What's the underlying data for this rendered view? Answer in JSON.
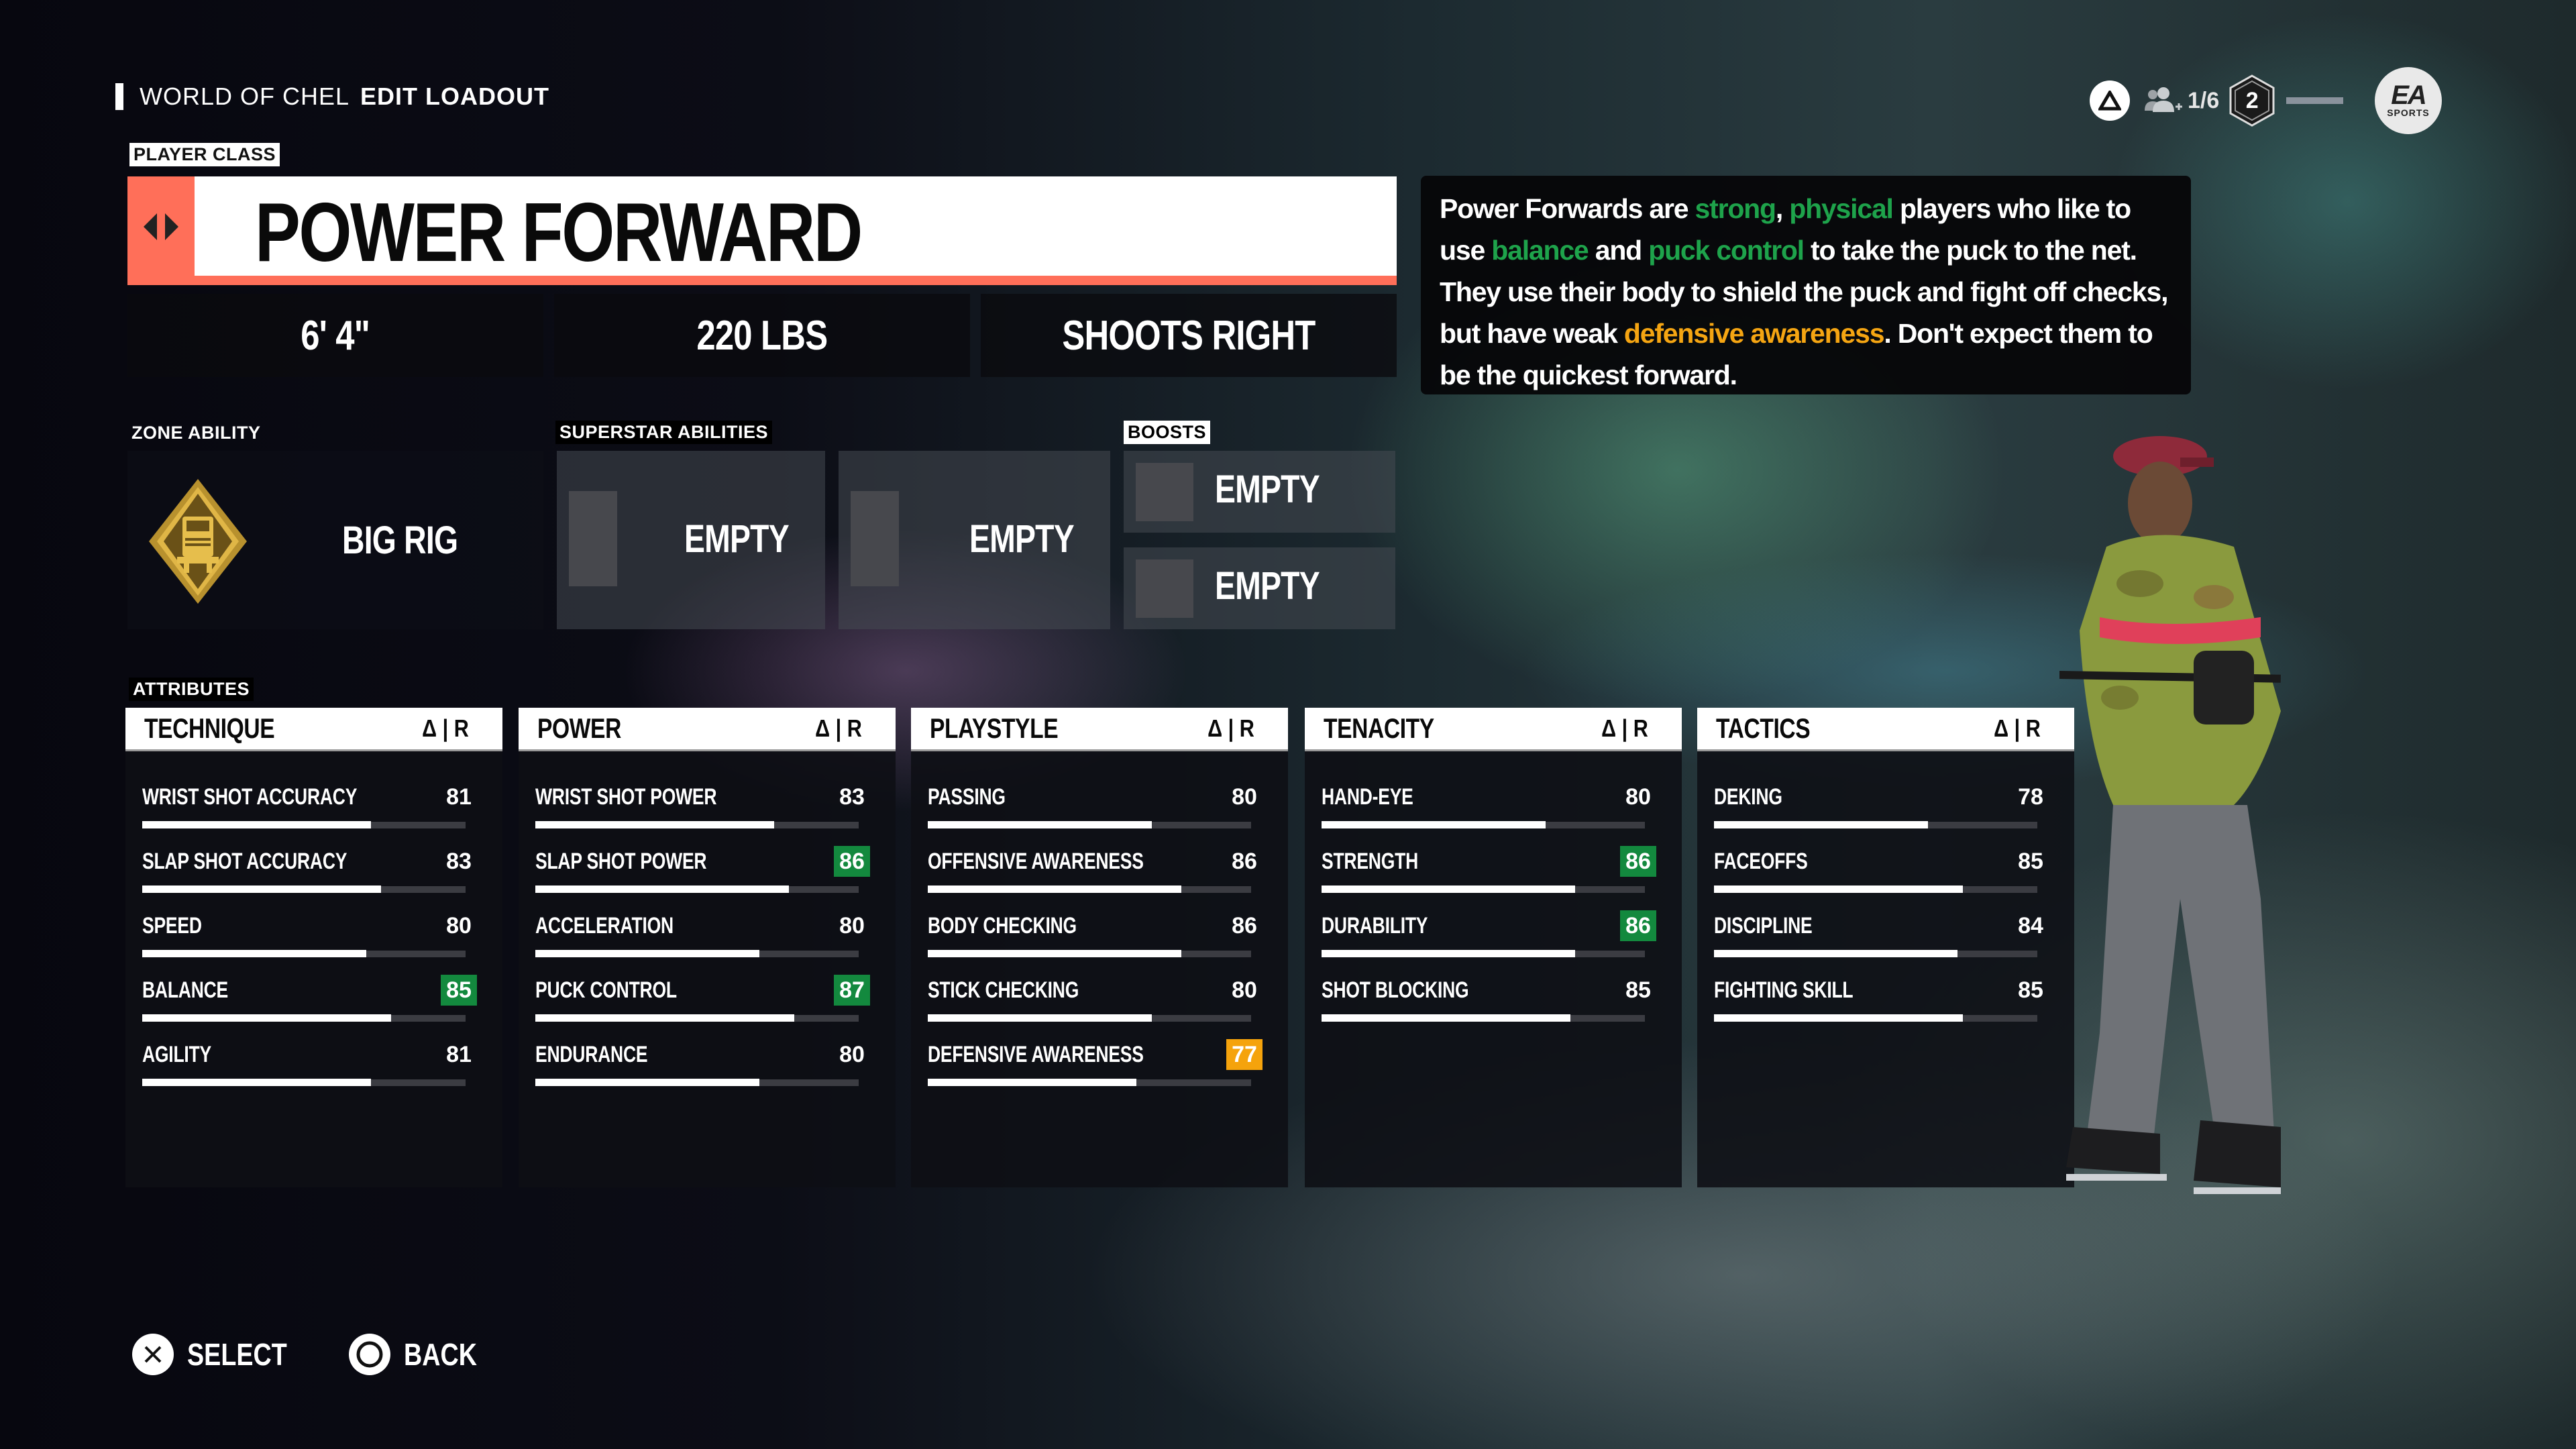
{
  "header": {
    "breadcrumb_section": "WORLD OF CHEL",
    "page_title": "EDIT LOADOUT"
  },
  "hud": {
    "triangle_button_icon": "playstation-triangle-icon",
    "party_icon": "add-party-member-icon",
    "party_count": "1/6",
    "level": "2",
    "brand_logo": {
      "top": "EA",
      "bottom": "SPORTS"
    }
  },
  "player_class": {
    "section_label": "PLAYER CLASS",
    "name": "POWER FORWARD",
    "accent_color": "#ff6f59",
    "height": "6' 4\"",
    "weight": "220 LBS",
    "handedness": "SHOOTS RIGHT"
  },
  "description": {
    "segments": [
      {
        "text": "Power Forwards are ",
        "tone": "normal"
      },
      {
        "text": "strong",
        "tone": "positive"
      },
      {
        "text": ", ",
        "tone": "normal"
      },
      {
        "text": "physical",
        "tone": "positive"
      },
      {
        "text": " players who like to use ",
        "tone": "normal"
      },
      {
        "text": "balance",
        "tone": "positive"
      },
      {
        "text": " and ",
        "tone": "normal"
      },
      {
        "text": "puck control",
        "tone": "positive"
      },
      {
        "text": " to take the puck to the net. They use their body to shield the puck and fight off checks, but have weak ",
        "tone": "normal"
      },
      {
        "text": "defensive awareness",
        "tone": "negative"
      },
      {
        "text": ". Don't expect them to be the quickest forward.",
        "tone": "normal"
      }
    ],
    "colors": {
      "positive": "#1ea34b",
      "negative": "#f5a512",
      "normal": "#ffffff"
    }
  },
  "abilities": {
    "zone_label": "ZONE ABILITY",
    "zone_ability": {
      "name": "BIG RIG",
      "icon": "big-rig-truck-icon"
    },
    "superstar_label": "SUPERSTAR ABILITIES",
    "superstar": [
      {
        "name": "EMPTY"
      },
      {
        "name": "EMPTY"
      }
    ],
    "boosts_label": "BOOSTS",
    "boosts": [
      {
        "name": "EMPTY"
      },
      {
        "name": "EMPTY"
      }
    ]
  },
  "attributes": {
    "section_label": "ATTRIBUTES",
    "column_suffix": "Δ | R",
    "status_colors": {
      "up": "#13893e",
      "down": "#f5a30c"
    },
    "max_value": 100,
    "categories": [
      {
        "name": "TECHNIQUE",
        "items": [
          {
            "label": "WRIST SHOT ACCURACY",
            "value": 81,
            "status": "none"
          },
          {
            "label": "SLAP SHOT ACCURACY",
            "value": 83,
            "status": "none"
          },
          {
            "label": "SPEED",
            "value": 80,
            "status": "none"
          },
          {
            "label": "BALANCE",
            "value": 85,
            "status": "up"
          },
          {
            "label": "AGILITY",
            "value": 81,
            "status": "none"
          }
        ]
      },
      {
        "name": "POWER",
        "items": [
          {
            "label": "WRIST SHOT POWER",
            "value": 83,
            "status": "none"
          },
          {
            "label": "SLAP SHOT POWER",
            "value": 86,
            "status": "up"
          },
          {
            "label": "ACCELERATION",
            "value": 80,
            "status": "none"
          },
          {
            "label": "PUCK CONTROL",
            "value": 87,
            "status": "up"
          },
          {
            "label": "ENDURANCE",
            "value": 80,
            "status": "none"
          }
        ]
      },
      {
        "name": "PLAYSTYLE",
        "items": [
          {
            "label": "PASSING",
            "value": 80,
            "status": "none"
          },
          {
            "label": "OFFENSIVE AWARENESS",
            "value": 86,
            "status": "none"
          },
          {
            "label": "BODY CHECKING",
            "value": 86,
            "status": "none"
          },
          {
            "label": "STICK CHECKING",
            "value": 80,
            "status": "none"
          },
          {
            "label": "DEFENSIVE AWARENESS",
            "value": 77,
            "status": "down"
          }
        ]
      },
      {
        "name": "TENACITY",
        "items": [
          {
            "label": "HAND-EYE",
            "value": 80,
            "status": "none"
          },
          {
            "label": "STRENGTH",
            "value": 86,
            "status": "up"
          },
          {
            "label": "DURABILITY",
            "value": 86,
            "status": "up"
          },
          {
            "label": "SHOT BLOCKING",
            "value": 85,
            "status": "none"
          }
        ]
      },
      {
        "name": "TACTICS",
        "items": [
          {
            "label": "DEKING",
            "value": 78,
            "status": "none"
          },
          {
            "label": "FACEOFFS",
            "value": 85,
            "status": "none"
          },
          {
            "label": "DISCIPLINE",
            "value": 84,
            "status": "none"
          },
          {
            "label": "FIGHTING SKILL",
            "value": 85,
            "status": "none"
          }
        ]
      }
    ]
  },
  "prompts": [
    {
      "icon": "cross-button-icon",
      "label": "SELECT"
    },
    {
      "icon": "circle-button-icon",
      "label": "BACK"
    }
  ]
}
